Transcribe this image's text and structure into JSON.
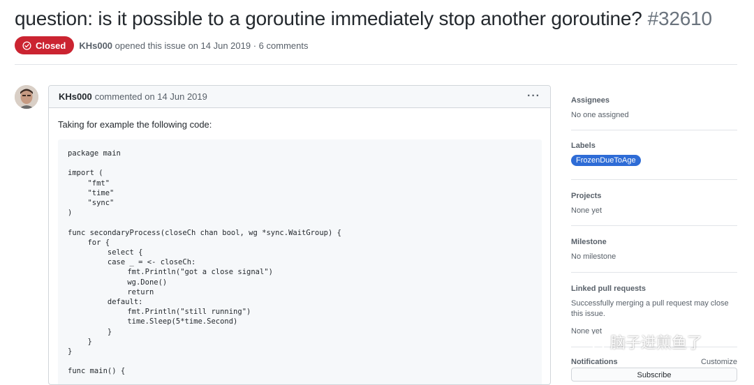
{
  "issue": {
    "title": "question: is it possible to a goroutine immediately stop another goroutine?",
    "number": "#32610",
    "state_label": "Closed",
    "author": "KHs000",
    "opened_text": "opened this issue on 14 Jun 2019",
    "comments_text": "· 6 comments"
  },
  "comment": {
    "author": "KHs000",
    "meta": "commented on 14 Jun 2019",
    "menu": "···",
    "intro": "Taking for example the following code:",
    "code": "package main\n\nimport (\n\t\"fmt\"\n\t\"time\"\n\t\"sync\"\n)\n\nfunc secondaryProcess(closeCh chan bool, wg *sync.WaitGroup) {\n\tfor {\n\t\tselect {\n\t\tcase _ = <- closeCh:\n\t\t\tfmt.Println(\"got a close signal\")\n\t\t\twg.Done()\n\t\t\treturn\n\t\tdefault:\n\t\t\tfmt.Println(\"still running\")\n\t\t\ttime.Sleep(5*time.Second)\n\t\t}\n\t}\n}\n\nfunc main() {"
  },
  "sidebar": {
    "assignees": {
      "heading": "Assignees",
      "value": "No one assigned"
    },
    "labels": {
      "heading": "Labels",
      "label": "FrozenDueToAge",
      "label_color": "#2e6cd6"
    },
    "projects": {
      "heading": "Projects",
      "value": "None yet"
    },
    "milestone": {
      "heading": "Milestone",
      "value": "No milestone"
    },
    "linked_prs": {
      "heading": "Linked pull requests",
      "value": "Successfully merging a pull request may close this issue.",
      "value2": "None yet"
    },
    "notifications": {
      "heading": "Notifications",
      "customize": "Customize",
      "subscribe": "Subscribe"
    }
  },
  "watermark": {
    "text": "脑子进煎鱼了",
    "icon": "wechat-icon"
  },
  "colors": {
    "closed": "#cb2431",
    "label": "#2e6cd6"
  }
}
